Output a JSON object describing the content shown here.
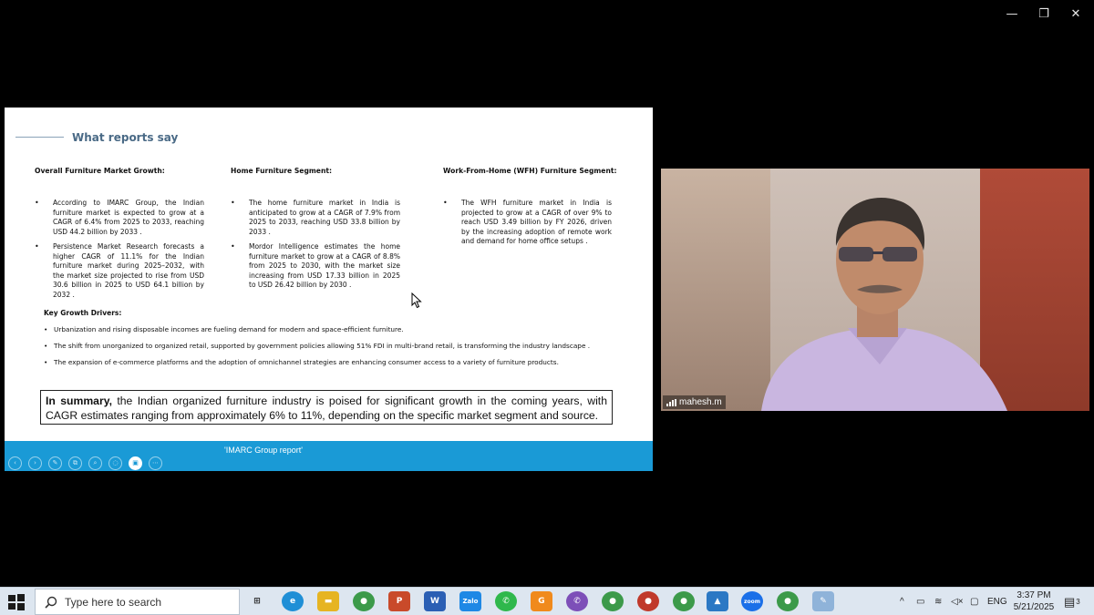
{
  "window_controls": {
    "minimize": "—",
    "restore": "❐",
    "close": "✕"
  },
  "slide": {
    "title": "What reports say",
    "columns": [
      {
        "heading": "Overall Furniture Market Growth:",
        "bullets": [
          "According to IMARC Group, the Indian furniture market is expected to grow at a CAGR of 6.4% from 2025 to 2033, reaching USD 44.2 billion by 2033 .",
          "Persistence Market Research forecasts a higher CAGR of 11.1% for the Indian furniture market during 2025–2032, with the market size projected to rise from USD 30.6 billion in 2025 to USD 64.1 billion by 2032 ."
        ]
      },
      {
        "heading": "Home Furniture Segment:",
        "bullets": [
          "The home furniture market in India is anticipated to grow at a CAGR of 7.9% from 2025 to 2033, reaching USD 33.8 billion by 2033 .",
          "Mordor Intelligence estimates the home furniture market to grow at a CAGR of 8.8% from 2025 to 2030, with the market size increasing from USD 17.33 billion in 2025 to USD 26.42 billion by 2030 ."
        ]
      },
      {
        "heading": "Work-From-Home (WFH) Furniture Segment:",
        "bullets": [
          "The WFH furniture market in India is projected to grow at a CAGR of over 9% to reach USD 3.49 billion by FY 2026, driven by the increasing adoption of remote work and demand for home office setups ."
        ]
      }
    ],
    "drivers": {
      "heading": "Key Growth Drivers:",
      "items": [
        "Urbanization and rising disposable incomes are fueling demand for modern and space-efficient furniture.",
        "The shift from unorganized to organized retail, supported by government policies allowing 51% FDI in multi-brand retail, is transforming the industry landscape .",
        "The expansion of e-commerce platforms and the adoption of omnichannel strategies are enhancing consumer access to a variety of furniture products."
      ]
    },
    "summary": {
      "lead": "In summary,",
      "text": " the Indian organized furniture industry is poised for significant growth in the coming years, with CAGR estimates ranging from approximately 6% to 11%, depending on the specific market segment and source."
    },
    "caption": "'IMARC Group report'",
    "controls": [
      "‹",
      "›",
      "✎",
      "⧉",
      "⌕",
      "◌",
      "▣",
      "⋯"
    ]
  },
  "video": {
    "participant_name": "mahesh.m"
  },
  "taskbar": {
    "search_placeholder": "Type here to search",
    "apps": [
      {
        "name": "task-view",
        "label": "⊞",
        "color": "#dde6f0"
      },
      {
        "name": "edge",
        "label": "e",
        "color": "#1f8fd6"
      },
      {
        "name": "file-explorer",
        "label": "▬",
        "color": "#e6b422"
      },
      {
        "name": "chrome",
        "label": "●",
        "color": "#3c9a4a"
      },
      {
        "name": "powerpoint",
        "label": "P",
        "color": "#c94a2a"
      },
      {
        "name": "word",
        "label": "W",
        "color": "#2b5fb4"
      },
      {
        "name": "zalo",
        "label": "Zalo",
        "color": "#1e88e5"
      },
      {
        "name": "whatsapp",
        "label": "✆",
        "color": "#2fb84c"
      },
      {
        "name": "app-orange",
        "label": "G",
        "color": "#f08a1c"
      },
      {
        "name": "viber",
        "label": "✆",
        "color": "#7d4fb8"
      },
      {
        "name": "chrome-profile-1",
        "label": "●",
        "color": "#3c9a4a"
      },
      {
        "name": "chrome-profile-2",
        "label": "●",
        "color": "#c0392b"
      },
      {
        "name": "chrome-profile-3",
        "label": "●",
        "color": "#3c9a4a"
      },
      {
        "name": "photos",
        "label": "▲",
        "color": "#2b78c4"
      },
      {
        "name": "zoom",
        "label": "zoom",
        "color": "#1a6fe8"
      },
      {
        "name": "chrome-profile-4",
        "label": "●",
        "color": "#3c9a4a"
      },
      {
        "name": "paint",
        "label": "✎",
        "color": "#8fb3d9"
      }
    ],
    "language": "ENG",
    "time": "3:37 PM",
    "date": "5/21/2025",
    "notification_count": "3"
  }
}
